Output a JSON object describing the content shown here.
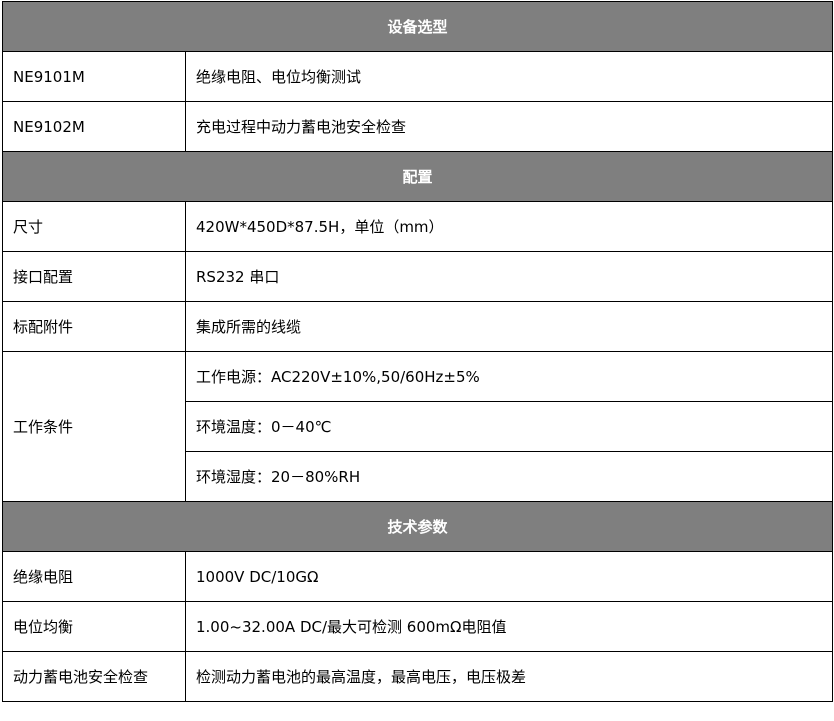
{
  "sections": [
    {
      "title": "设备选型",
      "rows": [
        {
          "label": "NE9101M",
          "value": "绝缘电阻、电位均衡测试"
        },
        {
          "label": "NE9102M",
          "value": "充电过程中动力蓄电池安全检查"
        }
      ]
    },
    {
      "title": "配置",
      "rows": [
        {
          "label": "尺寸",
          "value": "420W*450D*87.5H，单位（mm）"
        },
        {
          "label": "接口配置",
          "value": "RS232 串口"
        },
        {
          "label": "标配附件",
          "value": "集成所需的线缆"
        }
      ],
      "conditions": {
        "label": "工作条件",
        "values": [
          "工作电源：AC220V±10%,50/60Hz±5%",
          "环境温度：0－40℃",
          "环境湿度：20－80%RH"
        ]
      }
    },
    {
      "title": "技术参数",
      "rows": [
        {
          "label": "绝缘电阻",
          "value": "1000V DC/10GΩ"
        },
        {
          "label": "电位均衡",
          "value": "1.00~32.00A DC/最大可检测 600mΩ电阻值"
        },
        {
          "label": "动力蓄电池安全检查",
          "value": "检测动力蓄电池的最高温度，最高电压，电压极差"
        }
      ]
    }
  ]
}
